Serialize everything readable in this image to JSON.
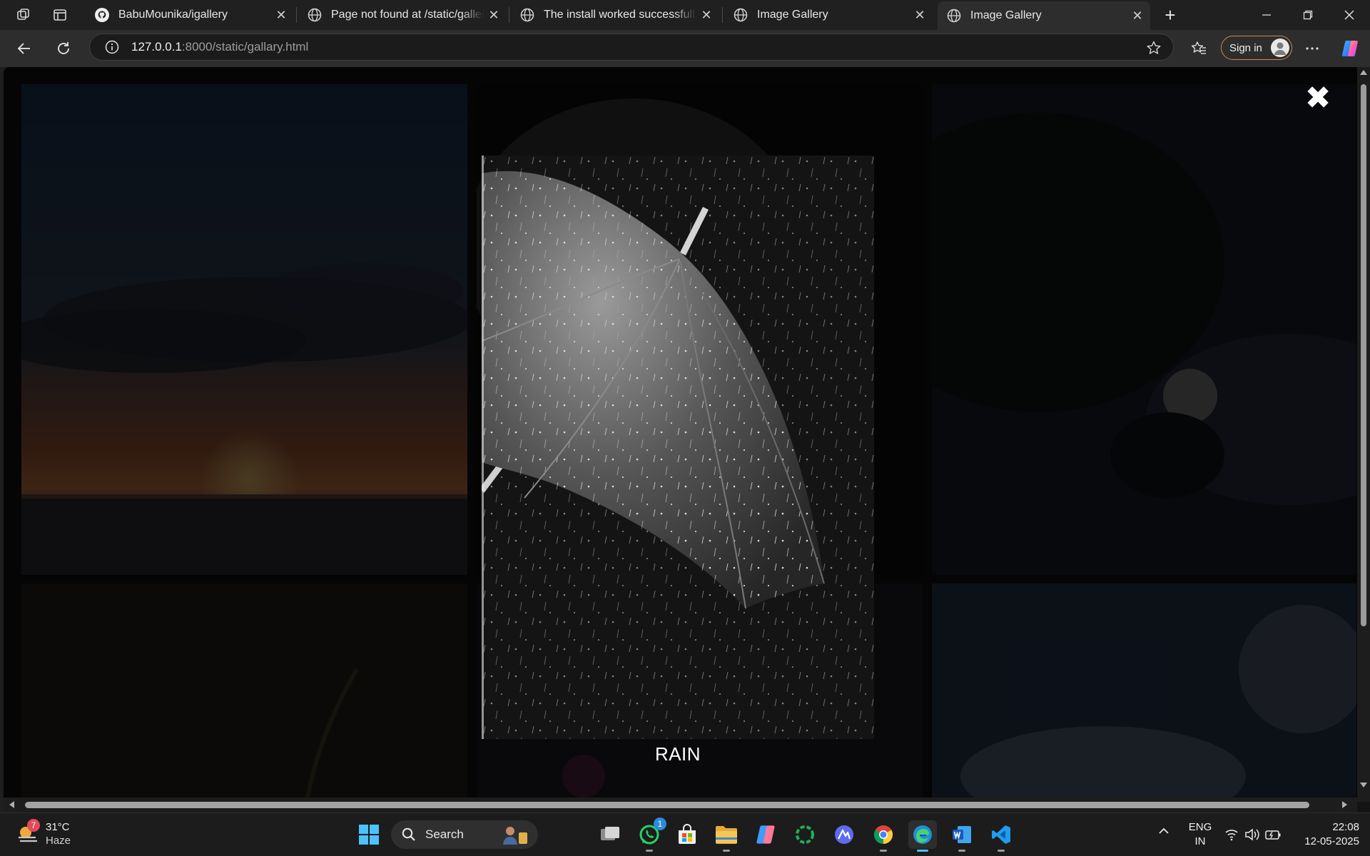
{
  "browser": {
    "tabs": [
      {
        "title": "BabuMounika/igallery",
        "favicon": "github-icon",
        "active": false
      },
      {
        "title": "Page not found at /static/gallery.html",
        "favicon": "globe-icon",
        "active": false
      },
      {
        "title": "The install worked successfully! Congratulations!",
        "favicon": "globe-icon",
        "active": false
      },
      {
        "title": "Image Gallery",
        "favicon": "globe-icon",
        "active": false
      },
      {
        "title": "Image Gallery",
        "favicon": "globe-icon",
        "active": true
      }
    ],
    "url_host": "127.0.0.1",
    "url_rest": ":8000/static/gallary.html",
    "signin_label": "Sign in"
  },
  "page": {
    "lightbox": {
      "caption": "RAIN",
      "close_symbol": "✖"
    }
  },
  "taskbar": {
    "weather": {
      "temp": "31°C",
      "condition": "Haze",
      "badge": "7"
    },
    "search_label": "Search",
    "whatsapp_badge": "1",
    "language": {
      "line1": "ENG",
      "line2": "IN"
    },
    "clock": {
      "time": "22:08",
      "date": "12-05-2025"
    }
  },
  "colors": {
    "accent": "#4cc2ff",
    "signin_border": "#d08a3f",
    "weather_badge": "#e04a5a"
  }
}
